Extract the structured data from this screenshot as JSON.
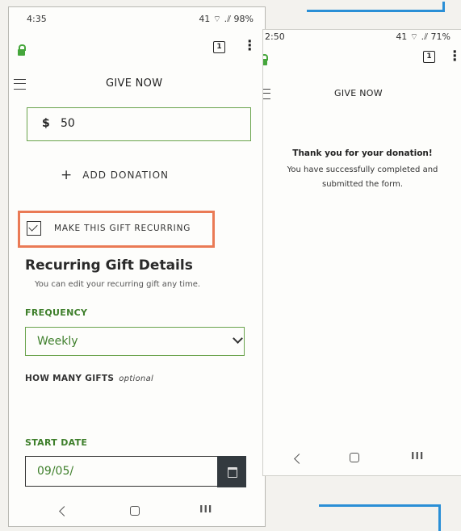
{
  "left_phone": {
    "status": {
      "time": "4:35",
      "indicators": "41 ⌔ .⫽ 98%"
    },
    "tabs_count": "1",
    "header": {
      "title": "GIVE NOW"
    },
    "donation": {
      "currency": "$",
      "amount": "50"
    },
    "add_donation_label": "ADD DONATION",
    "recurring_checkbox": {
      "label": "MAKE THIS GIFT RECURRING",
      "checked": true
    },
    "recurring_details": {
      "heading": "Recurring Gift Details",
      "subtext": "You can edit your recurring gift any time.",
      "frequency_label": "FREQUENCY",
      "frequency_value": "Weekly",
      "how_many_label": "HOW MANY GIFTS",
      "how_many_optional": "optional",
      "start_date_label": "START DATE",
      "start_date_value": "09/05/"
    }
  },
  "right_phone": {
    "status": {
      "time": "2:50",
      "indicators": "41 ⌔ .⫽ 71%"
    },
    "tabs_count": "1",
    "header": {
      "title": "GIVE NOW"
    },
    "thank_you_title": "Thank you for your donation!",
    "thank_you_line1": "You have successfully completed and",
    "thank_you_line2": "submitted the form."
  },
  "colors": {
    "accent_green": "#3e7f2b",
    "highlight_orange": "#ea7a55",
    "annotation_blue": "#2a8fd6"
  },
  "icons": [
    "lock-icon",
    "tabs-icon",
    "more-vert-icon",
    "hamburger-icon",
    "plus-icon",
    "checkbox-checked-icon",
    "chevron-down-icon",
    "calendar-icon",
    "back-icon",
    "home-icon",
    "recents-icon"
  ]
}
